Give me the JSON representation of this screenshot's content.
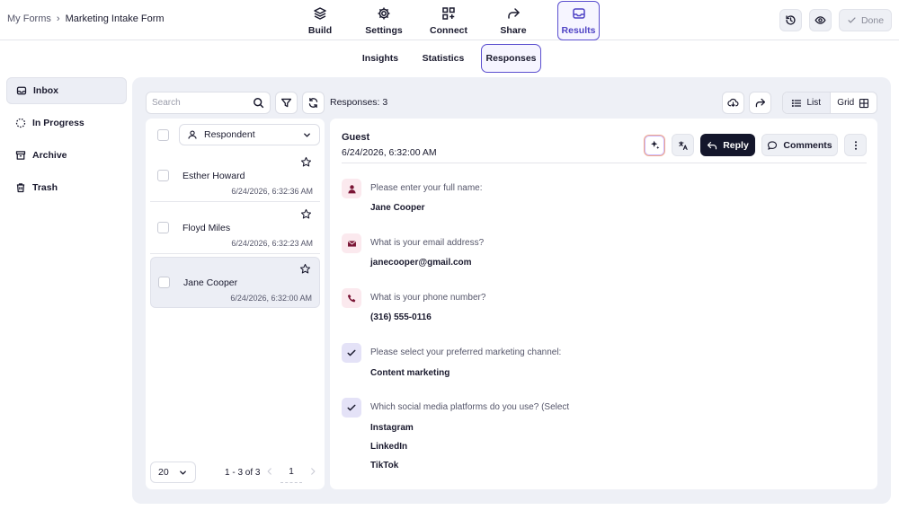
{
  "breadcrumb": {
    "root": "My Forms",
    "separator": "›",
    "current": "Marketing Intake Form"
  },
  "nav": {
    "build": "Build",
    "settings": "Settings",
    "connect": "Connect",
    "share": "Share",
    "results": "Results"
  },
  "actions": {
    "done": "Done"
  },
  "subtabs": {
    "insights": "Insights",
    "statistics": "Statistics",
    "responses": "Responses"
  },
  "sidebar": {
    "items": [
      {
        "label": "Inbox",
        "icon": "inbox-icon"
      },
      {
        "label": "In Progress",
        "icon": "progress-icon"
      },
      {
        "label": "Archive",
        "icon": "archive-icon"
      },
      {
        "label": "Trash",
        "icon": "trash-icon"
      }
    ]
  },
  "toolbar": {
    "search_placeholder": "Search",
    "responses_count": "Responses: 3",
    "view_list": "List",
    "view_grid": "Grid"
  },
  "list": {
    "filter_label": "Respondent",
    "responses": [
      {
        "name": "Esther Howard",
        "date": "6/24/2026, 6:32:36 AM"
      },
      {
        "name": "Floyd Miles",
        "date": "6/24/2026, 6:32:23 AM"
      },
      {
        "name": "Jane Cooper",
        "date": "6/24/2026, 6:32:00 AM"
      }
    ],
    "page_size": "20",
    "range": "1 - 3 of 3",
    "page": "1"
  },
  "detail": {
    "name": "Guest",
    "date": "6/24/2026, 6:32:00 AM",
    "reply": "Reply",
    "comments": "Comments",
    "questions": [
      {
        "icon": "person-icon",
        "q": "Please enter your full name:",
        "answers": [
          "Jane Cooper"
        ]
      },
      {
        "icon": "mail-icon",
        "q": "What is your email address?",
        "answers": [
          "janecooper@gmail.com"
        ]
      },
      {
        "icon": "phone-icon",
        "q": "What is your phone number?",
        "answers": [
          "(316) 555-0116"
        ]
      },
      {
        "icon": "check-icon",
        "q": "Please select your preferred marketing channel:",
        "answers": [
          "Content marketing"
        ]
      },
      {
        "icon": "check-icon",
        "q": "Which social media platforms do you use? (Select",
        "answers": [
          "Instagram",
          "LinkedIn",
          "TikTok"
        ]
      }
    ]
  },
  "colors": {
    "accent": "#5b4fcf",
    "reply_bg": "#14162b",
    "icon_maroon": "#7a1535",
    "panel_bg": "#eef0f6"
  }
}
